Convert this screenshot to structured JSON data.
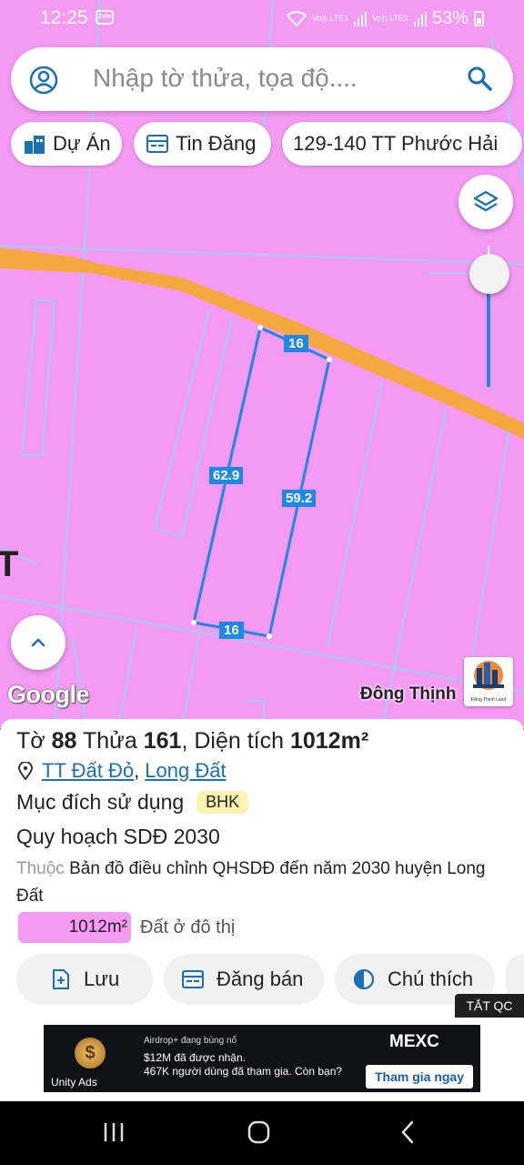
{
  "status_bar": {
    "time": "12:25",
    "zalo_label": "Zalo",
    "sim1": "Vo)) LTE1",
    "sim2": "Vo)) LTE2",
    "battery": "53%"
  },
  "search": {
    "placeholder": "Nhập tờ thửa, tọa độ...."
  },
  "chips": {
    "du_an": "Dự Án",
    "tin_dang": "Tin Đăng",
    "location": "129-140 TT Phước Hải"
  },
  "map": {
    "edge_labels": [
      "16",
      "62.9",
      "59.2",
      "16"
    ],
    "side_letter": "T",
    "google_logo": "Google",
    "attribution": "Đông Thịnh",
    "brand_logo_text": "Đông Thịnh Land",
    "zoom_level_fraction": 0.2
  },
  "parcel": {
    "sheet_label": "Tờ",
    "sheet_no": "88",
    "plot_label": "Thửa",
    "plot_no": "161",
    "area_label": "Diện tích",
    "area": "1012m²",
    "ward": "TT Đất Đỏ",
    "district": "Long Đất",
    "purpose_label": "Mục đích sử dụng",
    "purpose_code": "BHK",
    "plan_title": "Quy hoạch SDĐ 2030",
    "belongs_label": "Thuộc",
    "belongs_text": "Bản đồ điều chỉnh QHSDĐ đến năm 2030 huyện Long Đất",
    "land_area": "1012m²",
    "land_type": "Đất ở đô thị",
    "land_color": "#f49af5"
  },
  "actions": {
    "save": "Lưu",
    "post_sale": "Đăng bán",
    "legend": "Chú thích"
  },
  "ad": {
    "close_label": "TẮT QC",
    "line1": "Airdrop+ đang bùng nổ",
    "line2": "$12M đã được nhận.",
    "line3": "467K người dùng đã tham gia. Còn bạn?",
    "brand": "MEXC",
    "cta": "Tham gia ngay",
    "network": "Unity Ads"
  },
  "colors": {
    "map_pink": "#f49af5",
    "road_orange": "#f5a83f",
    "parcel_blue": "#1e88e5",
    "link_blue": "#1a6fb5",
    "badge_yellow": "#fdf1b0"
  }
}
